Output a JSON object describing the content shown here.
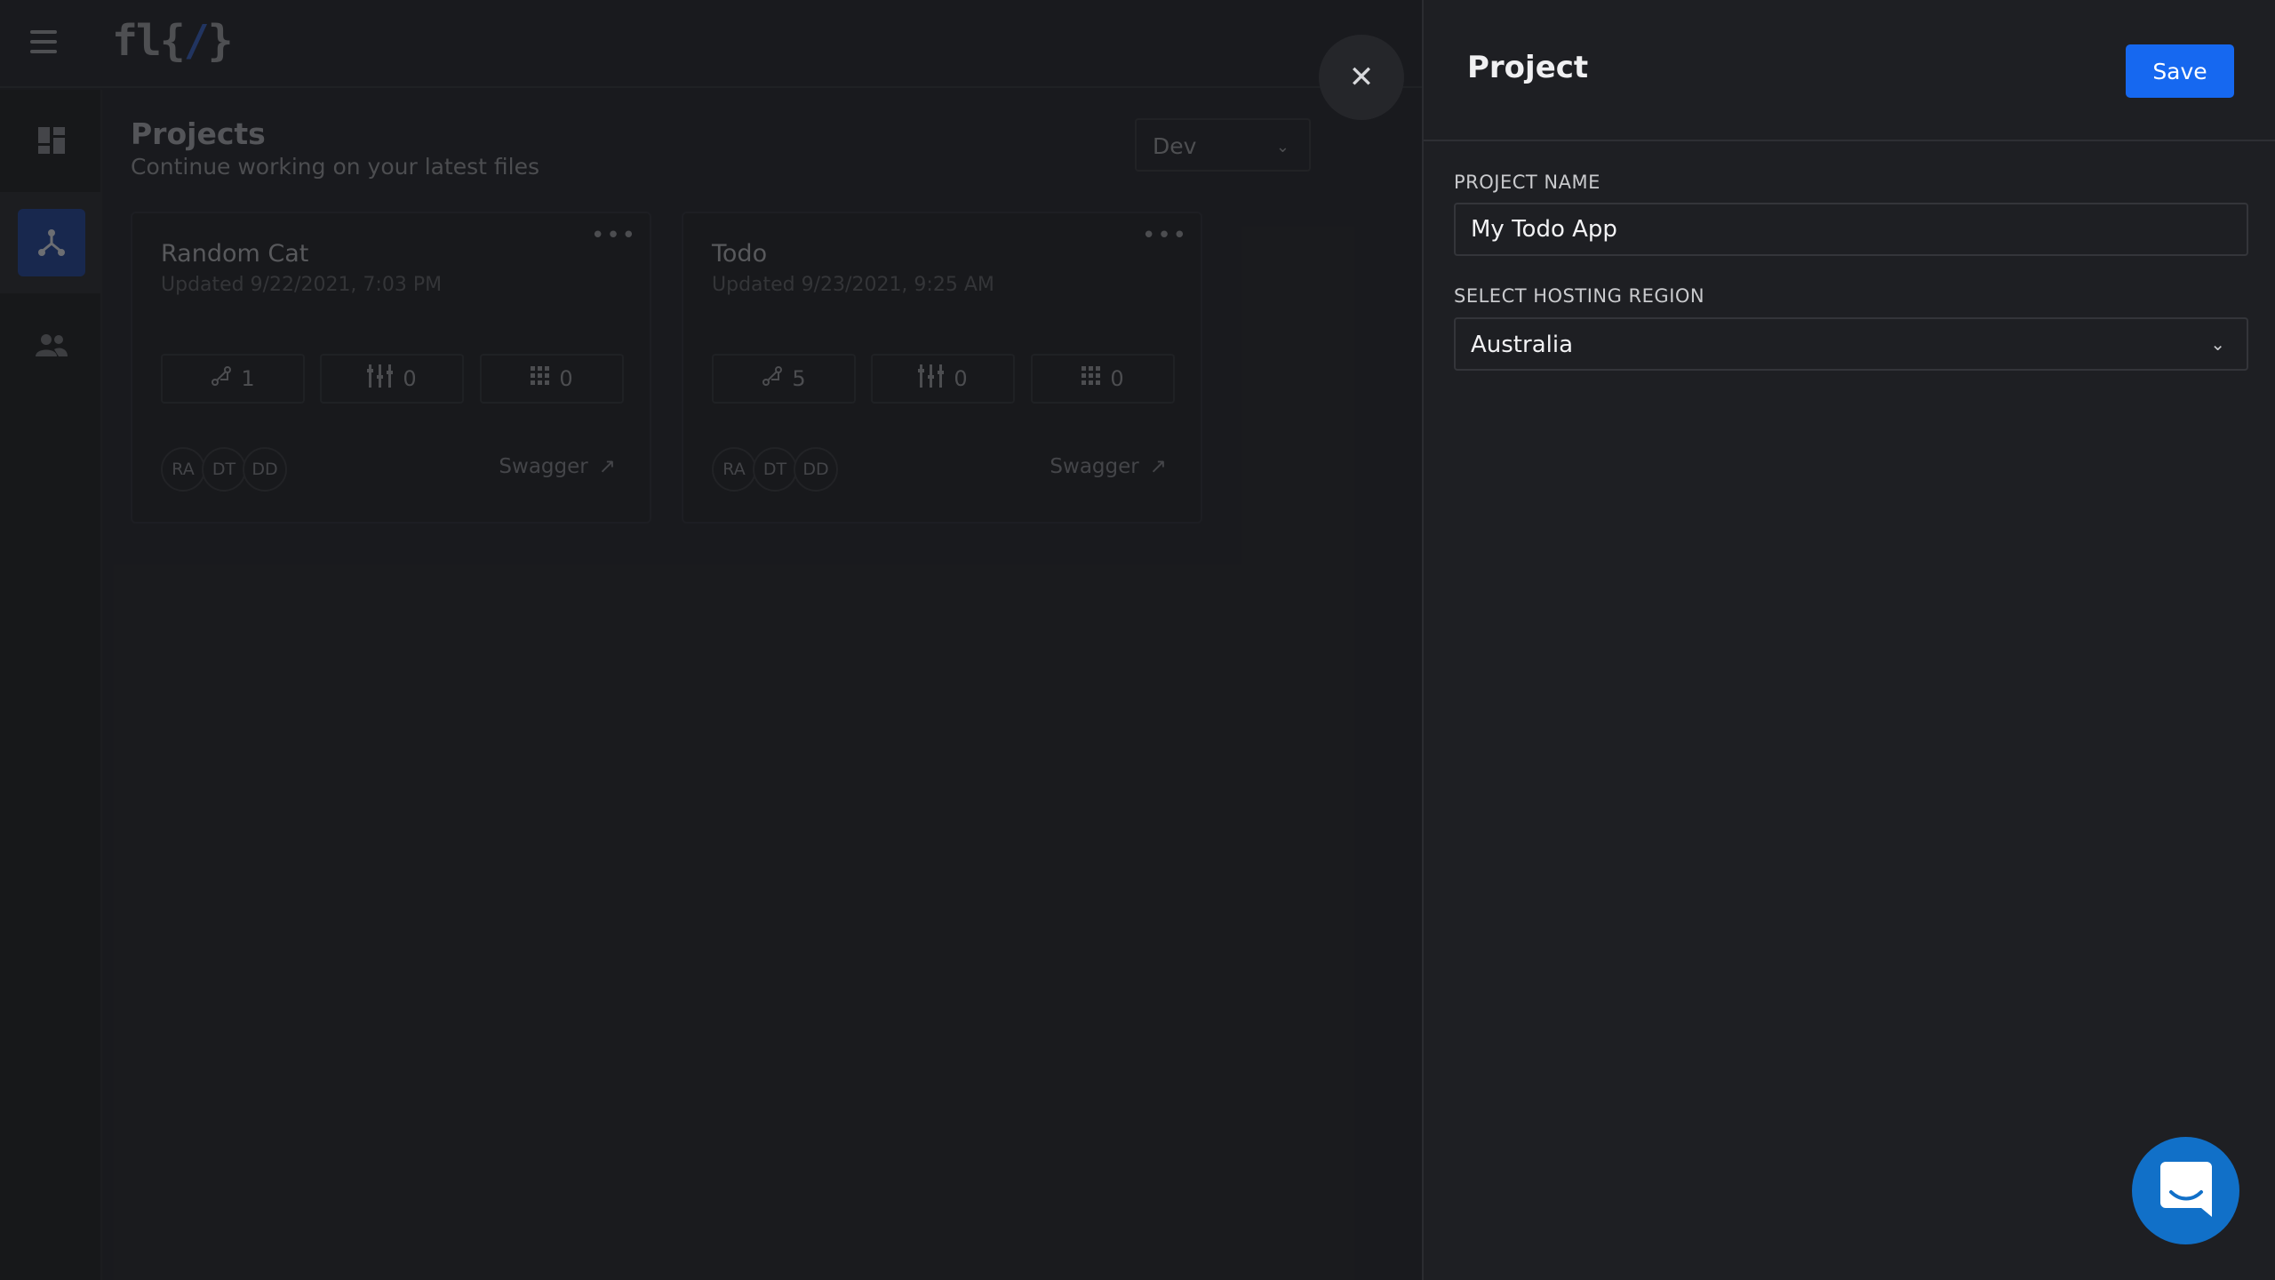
{
  "header": {
    "menu_icon": "hamburger-icon",
    "logo_text_a": "fl",
    "logo_text_b": "{",
    "logo_text_slash": "/",
    "logo_text_c": "}"
  },
  "sidebar": {
    "items": [
      {
        "icon": "dashboard-icon",
        "active": false
      },
      {
        "icon": "projects-icon",
        "active": true
      },
      {
        "icon": "team-icon",
        "active": false
      }
    ]
  },
  "main": {
    "title": "Projects",
    "subtitle": "Continue working on your latest files",
    "environment": "Dev",
    "cards": [
      {
        "name": "Random Cat",
        "updated": "Updated 9/22/2021, 7:03 PM",
        "stats": [
          "1",
          "0",
          "0"
        ],
        "avatars": [
          "RA",
          "DT",
          "DD"
        ],
        "link": "Swagger"
      },
      {
        "name": "Todo",
        "updated": "Updated 9/23/2021, 9:25 AM",
        "stats": [
          "5",
          "0",
          "0"
        ],
        "avatars": [
          "RA",
          "DT",
          "DD"
        ],
        "link": "Swagger"
      }
    ]
  },
  "panel": {
    "title": "Project",
    "save_label": "Save",
    "project_name_label": "PROJECT NAME",
    "project_name_value": "My Todo App",
    "region_label": "SELECT HOSTING REGION",
    "region_value": "Australia"
  },
  "colors": {
    "accent": "#1668f0",
    "chat": "#1170c8",
    "panel_bg": "#1e1f23"
  }
}
